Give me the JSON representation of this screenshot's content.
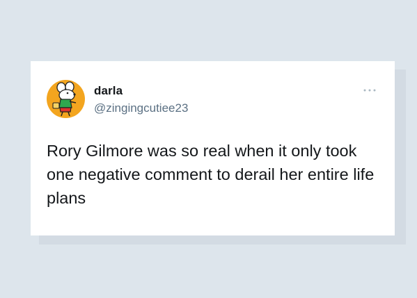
{
  "tweet": {
    "author": {
      "display_name": "darla",
      "handle": "@zingingcutiee23",
      "avatar_icon": "maisy-mouse-avatar",
      "avatar_color": "#f3a51f"
    },
    "more_icon": "more-dots-icon",
    "text": "Rory Gilmore was so real when it only took one negative comment to derail her entire life plans"
  }
}
